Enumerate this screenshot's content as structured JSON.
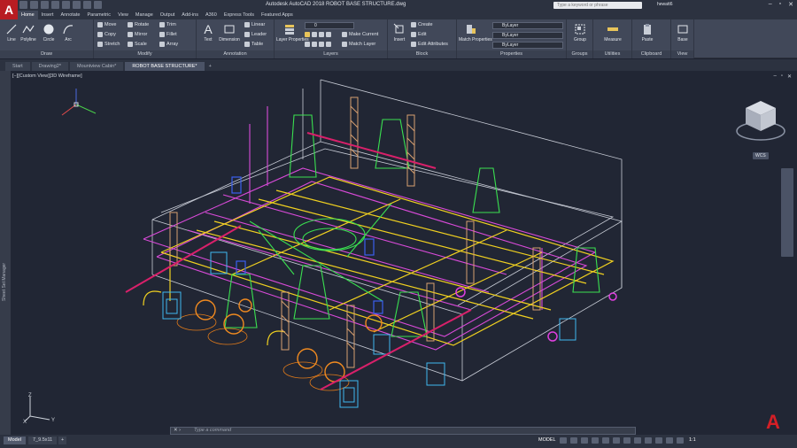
{
  "app": {
    "title": "Autodesk AutoCAD 2018   ROBOT BASE STRUCTURE.dwg",
    "logo_letter": "A",
    "search_placeholder": "Type a keyword or phrase",
    "user": "hewatt6",
    "accent_color": "#b81c22"
  },
  "ribbon_tabs": [
    "Home",
    "Insert",
    "Annotate",
    "Parametric",
    "View",
    "Manage",
    "Output",
    "Add-ins",
    "A360",
    "Express Tools",
    "Featured Apps"
  ],
  "ribbon": {
    "draw": {
      "title": "Draw",
      "line": "Line",
      "polyline": "Polyline",
      "circle": "Circle",
      "arc": "Arc"
    },
    "modify": {
      "title": "Modify",
      "move": "Move",
      "rotate": "Rotate",
      "trim": "Trim",
      "copy": "Copy",
      "mirror": "Mirror",
      "fillet": "Fillet",
      "stretch": "Stretch",
      "scale": "Scale",
      "array": "Array"
    },
    "annotation": {
      "title": "Annotation",
      "text": "Text",
      "dimension": "Dimension",
      "linear": "Linear",
      "leader": "Leader",
      "table": "Table"
    },
    "layers": {
      "title": "Layers",
      "layer_properties": "Layer Properties",
      "current_layer": "0",
      "make_current": "Make Current",
      "match_layer": "Match Layer"
    },
    "block": {
      "title": "Block",
      "insert": "Insert",
      "create": "Create",
      "edit": "Edit",
      "edit_attributes": "Edit Attributes"
    },
    "properties": {
      "title": "Properties",
      "match_properties": "Match Properties",
      "color": "ByLayer",
      "linetype": "ByLayer",
      "lineweight": "ByLayer"
    },
    "groups": {
      "title": "Groups",
      "group": "Group"
    },
    "utilities": {
      "title": "Utilities",
      "measure": "Measure"
    },
    "clipboard": {
      "title": "Clipboard",
      "paste": "Paste"
    },
    "view": {
      "title": "View",
      "base": "Base"
    }
  },
  "file_tabs": [
    {
      "label": "Start",
      "active": false
    },
    {
      "label": "Drawing2*",
      "active": false
    },
    {
      "label": "Mountview Cabin*",
      "active": false
    },
    {
      "label": "ROBOT BASE STRUCTURE*",
      "active": true
    }
  ],
  "viewport": {
    "label": "[−][Custom View][3D Wireframe]",
    "wcs": "WCS",
    "palette_label": "Sheet Set Manager",
    "ucs_x": "X",
    "ucs_y": "Y",
    "ucs_z": "Z"
  },
  "command_line": {
    "prompt": "Type a command"
  },
  "status_bar": {
    "layout_tabs": [
      {
        "label": "Model",
        "active": true
      },
      {
        "label": "7_9.5x11",
        "active": false
      }
    ],
    "model_label": "MODEL",
    "scale": "1:1"
  }
}
